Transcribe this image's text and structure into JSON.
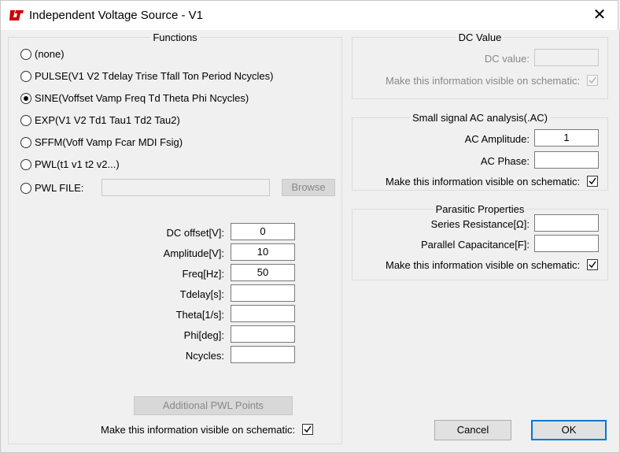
{
  "window": {
    "title": "Independent Voltage Source - V1",
    "close_glyph": "✕"
  },
  "functions": {
    "legend": "Functions",
    "options": [
      {
        "label": "(none)",
        "selected": false
      },
      {
        "label": "PULSE(V1 V2 Tdelay Trise Tfall Ton Period Ncycles)",
        "selected": false
      },
      {
        "label": "SINE(Voffset Vamp Freq Td Theta Phi Ncycles)",
        "selected": true
      },
      {
        "label": "EXP(V1 V2 Td1 Tau1 Td2 Tau2)",
        "selected": false
      },
      {
        "label": "SFFM(Voff Vamp Fcar MDI Fsig)",
        "selected": false
      },
      {
        "label": "PWL(t1 v1 t2 v2...)",
        "selected": false
      },
      {
        "label": "PWL FILE:",
        "selected": false
      }
    ],
    "pwl_file_value": "",
    "browse_label": "Browse",
    "params": [
      {
        "label": "DC offset[V]:",
        "value": "0"
      },
      {
        "label": "Amplitude[V]:",
        "value": "10"
      },
      {
        "label": "Freq[Hz]:",
        "value": "50"
      },
      {
        "label": "Tdelay[s]:",
        "value": ""
      },
      {
        "label": "Theta[1/s]:",
        "value": ""
      },
      {
        "label": "Phi[deg]:",
        "value": ""
      },
      {
        "label": "Ncycles:",
        "value": ""
      }
    ],
    "additional_pwl_label": "Additional PWL Points",
    "visible_label": "Make this information visible on schematic:",
    "visible_checked": true
  },
  "dc_value": {
    "legend": "DC Value",
    "label": "DC value:",
    "value": "",
    "visible_label": "Make this information visible on schematic:",
    "visible_checked": true
  },
  "ac": {
    "legend": "Small signal AC analysis(.AC)",
    "amplitude_label": "AC Amplitude:",
    "amplitude_value": "1",
    "phase_label": "AC Phase:",
    "phase_value": "",
    "visible_label": "Make this information visible on schematic:",
    "visible_checked": true
  },
  "parasitic": {
    "legend": "Parasitic Properties",
    "series_label": "Series Resistance[Ω]:",
    "series_value": "",
    "parallel_label": "Parallel Capacitance[F]:",
    "parallel_value": "",
    "visible_label": "Make this information visible on schematic:",
    "visible_checked": true
  },
  "buttons": {
    "cancel": "Cancel",
    "ok": "OK"
  }
}
